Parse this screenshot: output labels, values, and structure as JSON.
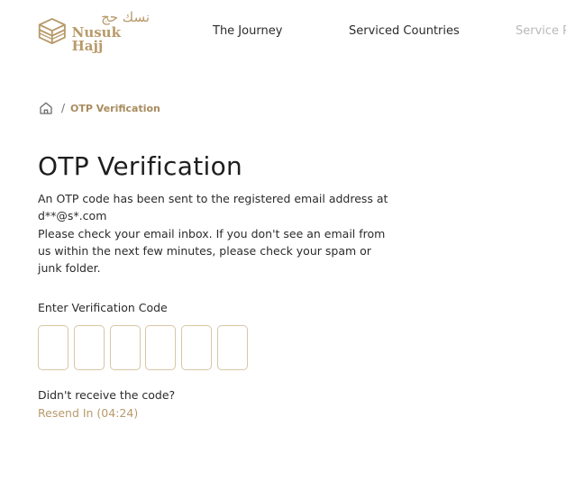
{
  "header": {
    "logo": {
      "arabic": "نسك حج",
      "english": "Nusuk Hajj"
    },
    "nav": [
      {
        "label": "The Journey"
      },
      {
        "label": "Serviced Countries"
      },
      {
        "label": "Service P"
      }
    ]
  },
  "breadcrumb": {
    "home_icon": "home-icon",
    "separator": "/",
    "current": "OTP Verification"
  },
  "main": {
    "title": "OTP Verification",
    "description_lines": [
      "An OTP code has been sent to the registered email address at",
      "d**@s*.com",
      "Please check your email inbox. If you don't see an email from",
      "us within the next few minutes, please check your spam or",
      "junk folder."
    ],
    "code_label": "Enter Verification Code",
    "otp_boxes": [
      "",
      "",
      "",
      "",
      "",
      ""
    ],
    "didnt_receive": "Didn't receive the code?",
    "resend_label": "Resend In (04:24)"
  },
  "colors": {
    "accent": "#b89a6a",
    "box_border": "#d8c6a6",
    "text": "#2b2b2b"
  }
}
